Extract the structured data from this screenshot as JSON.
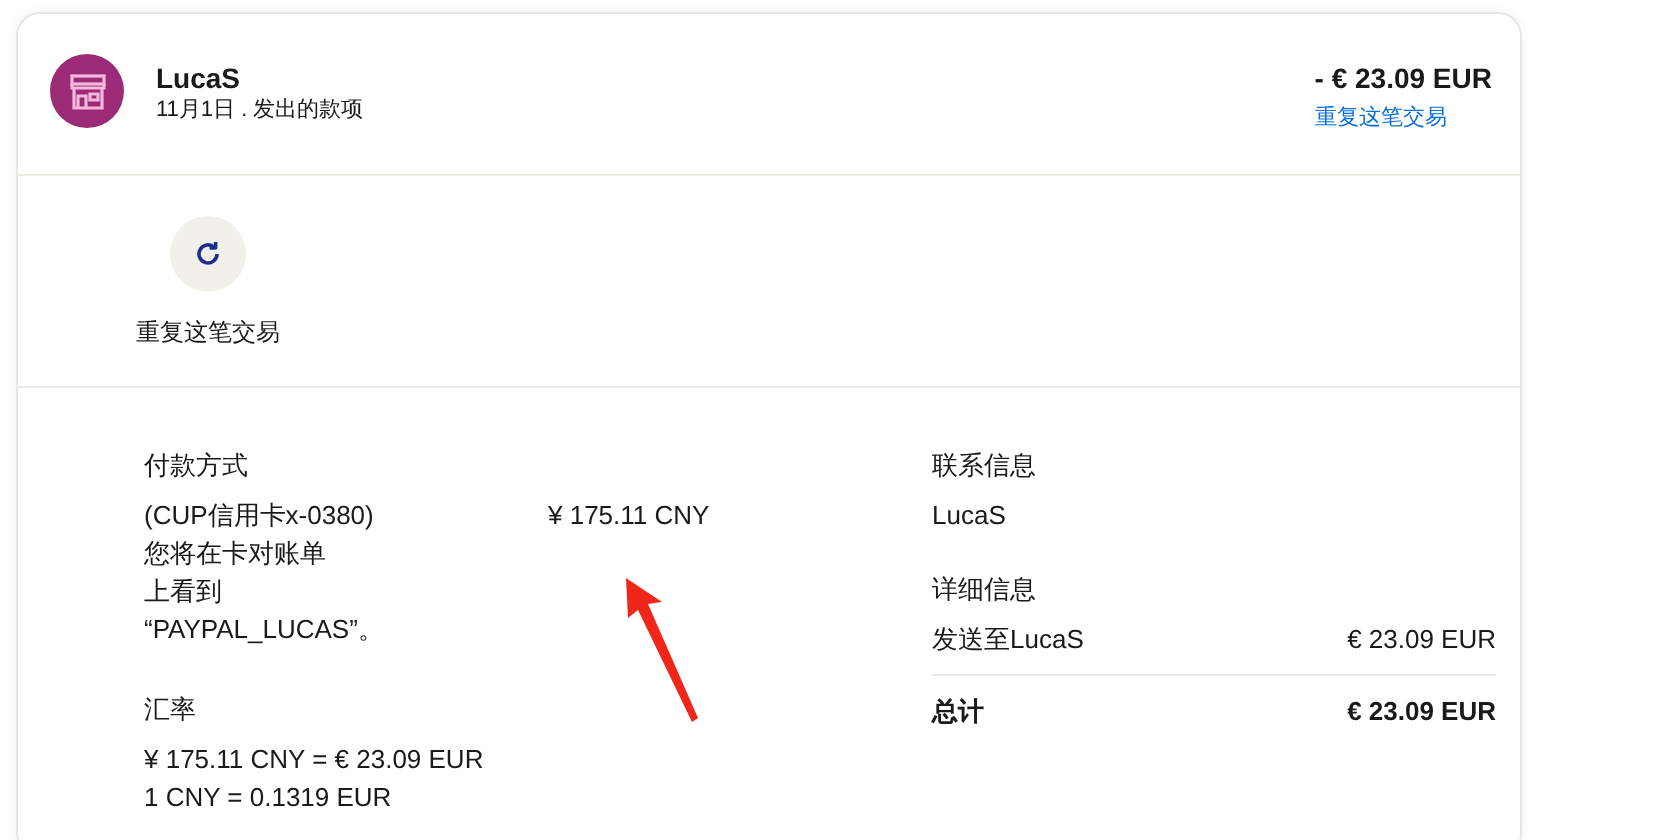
{
  "header": {
    "merchant": "LucaS",
    "subtitle": "11月1日 . 发出的款项",
    "amount": "- € 23.09 EUR",
    "repeat_link": "重复这笔交易"
  },
  "actions": [
    {
      "label": "重复这笔交易"
    }
  ],
  "payment": {
    "heading": "付款方式",
    "card": "(CUP信用卡x-0380)",
    "statement_note": [
      "您将在卡对账单",
      "上看到",
      "“PAYPAL_LUCAS”。"
    ],
    "charged": "¥ 175.11 CNY"
  },
  "exchange": {
    "heading": "汇率",
    "lines": [
      "¥ 175.11 CNY = € 23.09 EUR",
      "1 CNY = 0.1319 EUR"
    ]
  },
  "contact": {
    "heading": "联系信息",
    "name": "LucaS"
  },
  "details": {
    "heading": "详细信息",
    "rows": [
      {
        "label": "发送至LucaS",
        "amount": "€ 23.09 EUR",
        "kind": "item"
      },
      {
        "label": "总计",
        "amount": "€ 23.09 EUR",
        "kind": "total"
      }
    ]
  }
}
